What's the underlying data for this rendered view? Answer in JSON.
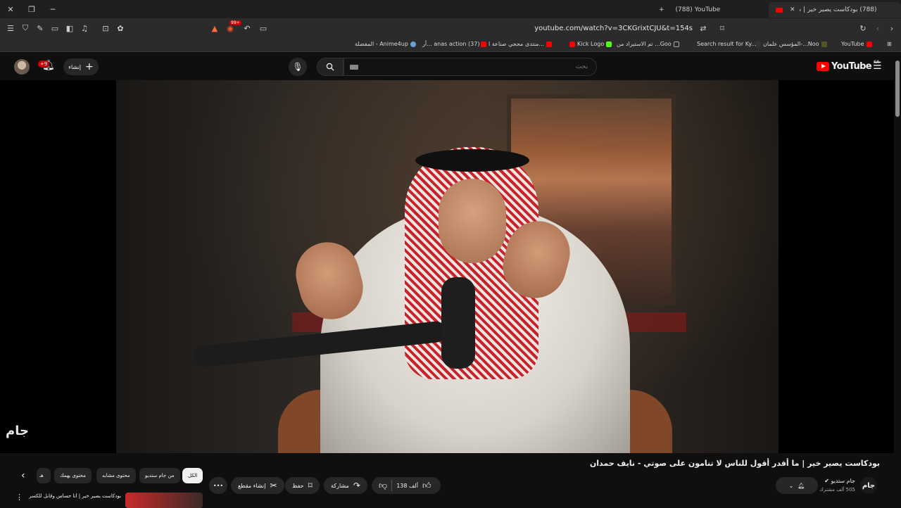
{
  "browser": {
    "tabs": [
      {
        "label": "(788) YouTube"
      },
      {
        "label": "(788) بودكاست يصير خير | ما أ..."
      }
    ],
    "url": "youtube.com/watch?v=3CKGrixtCJU&t=154s",
    "shield_count": "99+",
    "bookmarks": [
      {
        "label": "YouTube"
      },
      {
        "label": "المؤسس علمان-...Noo"
      },
      {
        "label": "Search result for Ky..."
      },
      {
        "label": "تم الاستيراد من ...Goo"
      },
      {
        "label": "Kick Logo"
      },
      {
        "label": "منتدى محجي صناعة ا..."
      },
      {
        "label": "أر... anas action (37)"
      },
      {
        "label": "المفضلة - Anime4up"
      }
    ]
  },
  "header": {
    "logo_text": "YouTube",
    "region": "SA",
    "search_placeholder": "بحث",
    "create_label": "إنشاء",
    "notif_badge": "+9"
  },
  "video": {
    "watermark": "جام",
    "title": "بودكاست يصير خير | ما أقدر أقول للناس لا تنامون على صوتي - نايف حمدان"
  },
  "channel": {
    "name": "جام ستديو",
    "subscribers": "505 ألف مشترك",
    "avatar_text": "جام"
  },
  "actions": {
    "likes": "138 ألف",
    "share": "مشاركة",
    "save": "حفظ",
    "clip": "إنشاء مقطع"
  },
  "chips": [
    {
      "label": "الكل"
    },
    {
      "label": "من جام ستديو"
    },
    {
      "label": "محتوى مشابه"
    },
    {
      "label": "محتوى يهمك"
    },
    {
      "label": "هـ"
    }
  ],
  "recommended": {
    "title": "بودكاست يصير خير | أنا حساس وقابل للكسر"
  }
}
